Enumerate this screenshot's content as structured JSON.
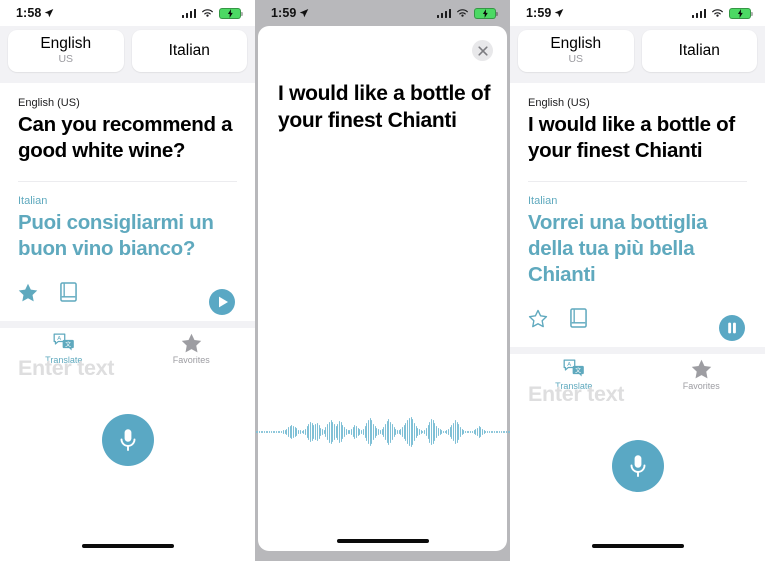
{
  "app": {
    "name": "Translate",
    "accent_color": "#5fa9be",
    "mic_color": "#5aa8c4"
  },
  "screens": [
    {
      "id": "screen-translate-result",
      "status_bar": {
        "time": "1:58",
        "location_icon": "location-arrow-icon",
        "signal_icon": "cellular-signal-icon",
        "wifi_icon": "wifi-icon",
        "battery_icon": "battery-charging-icon"
      },
      "language_bar": {
        "source": {
          "label": "English",
          "sub_label": "US"
        },
        "target": {
          "label": "Italian",
          "sub_label": ""
        }
      },
      "card": {
        "source_language_label": "English (US)",
        "source_text": "Can you recommend a good white wine?",
        "target_language_label": "Italian",
        "target_text": "Puoi consigliarmi un buon vino bianco?",
        "actions": {
          "favorite": {
            "icon": "star-filled-icon",
            "state": "on"
          },
          "dictionary": {
            "icon": "dictionary-book-icon",
            "state": "off"
          },
          "audio": {
            "icon": "play-circle-icon",
            "state": "paused"
          }
        }
      },
      "input": {
        "placeholder": "Enter text",
        "mic_icon": "microphone-icon"
      },
      "tabs": [
        {
          "label": "Translate",
          "icon": "translate-bubbles-icon",
          "active": true
        },
        {
          "label": "Favorites",
          "icon": "star-filled-icon",
          "active": false
        }
      ]
    },
    {
      "id": "screen-recording",
      "status_bar": {
        "time": "1:59",
        "location_icon": "location-arrow-icon",
        "signal_icon": "cellular-signal-icon",
        "wifi_icon": "wifi-icon",
        "battery_icon": "battery-charging-icon"
      },
      "close_button": {
        "icon": "close-x-icon",
        "label": ""
      },
      "recognized_text": "I would like a bottle of your finest Chianti",
      "waveform": {
        "icon": "audio-waveform",
        "color": "#7fc0d6",
        "amplitudes": [
          1,
          1,
          1,
          1,
          1,
          1,
          1,
          1,
          1,
          1,
          1,
          1,
          2,
          1,
          1,
          2,
          3,
          4,
          6,
          9,
          12,
          13,
          12,
          10,
          7,
          4,
          3,
          2,
          3,
          6,
          11,
          16,
          19,
          17,
          14,
          16,
          18,
          13,
          8,
          5,
          4,
          9,
          15,
          20,
          22,
          19,
          15,
          12,
          16,
          21,
          19,
          14,
          10,
          6,
          4,
          3,
          5,
          9,
          14,
          12,
          8,
          5,
          4,
          6,
          12,
          18,
          23,
          26,
          22,
          16,
          11,
          7,
          5,
          4,
          6,
          10,
          16,
          21,
          24,
          20,
          15,
          10,
          6,
          4,
          3,
          5,
          9,
          13,
          17,
          22,
          26,
          28,
          24,
          18,
          12,
          8,
          5,
          3,
          2,
          4,
          8,
          14,
          20,
          25,
          22,
          17,
          12,
          8,
          5,
          3,
          2,
          2,
          3,
          5,
          9,
          14,
          18,
          22,
          20,
          15,
          10,
          6,
          4,
          2,
          2,
          1,
          1,
          2,
          3,
          5,
          8,
          11,
          9,
          6,
          4,
          2,
          1,
          1,
          1,
          1,
          1,
          1,
          1,
          1,
          1,
          1,
          1,
          1,
          1,
          1
        ]
      }
    },
    {
      "id": "screen-translate-playing",
      "status_bar": {
        "time": "1:59",
        "location_icon": "location-arrow-icon",
        "signal_icon": "cellular-signal-icon",
        "wifi_icon": "wifi-icon",
        "battery_icon": "battery-charging-icon"
      },
      "language_bar": {
        "source": {
          "label": "English",
          "sub_label": "US"
        },
        "target": {
          "label": "Italian",
          "sub_label": ""
        }
      },
      "card": {
        "source_language_label": "English (US)",
        "source_text": "I would like a bottle of your finest Chianti",
        "target_language_label": "Italian",
        "target_text": "Vorrei una bottiglia della tua più bella Chianti",
        "actions": {
          "favorite": {
            "icon": "star-outline-icon",
            "state": "off"
          },
          "dictionary": {
            "icon": "dictionary-book-icon",
            "state": "off"
          },
          "audio": {
            "icon": "pause-circle-icon",
            "state": "playing"
          }
        }
      },
      "input": {
        "placeholder": "Enter text",
        "mic_icon": "microphone-icon"
      },
      "tabs": [
        {
          "label": "Translate",
          "icon": "translate-bubbles-icon",
          "active": true
        },
        {
          "label": "Favorites",
          "icon": "star-filled-icon",
          "active": false
        }
      ]
    }
  ]
}
